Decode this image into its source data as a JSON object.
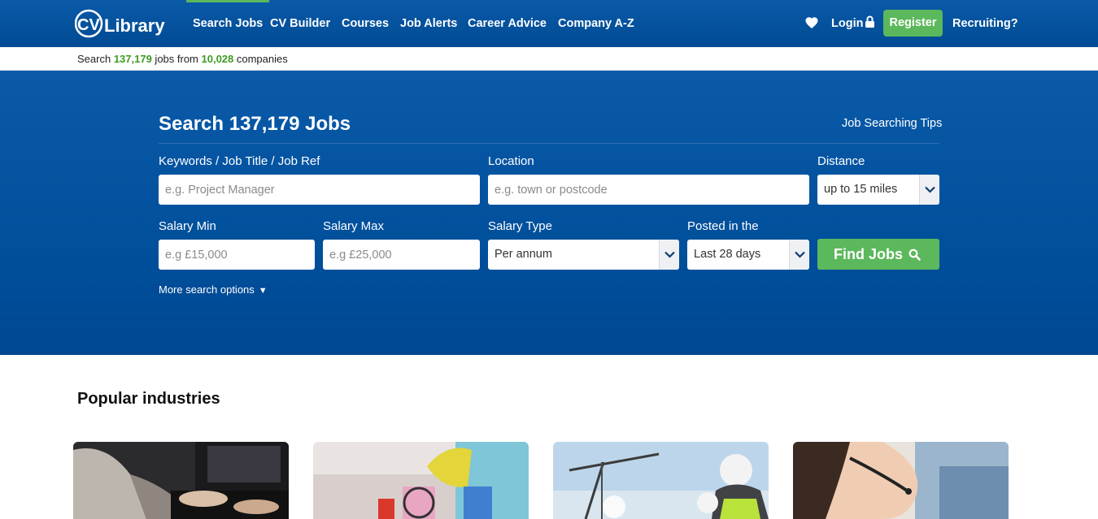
{
  "brand": {
    "logo_text": "CV Library"
  },
  "nav": {
    "items": [
      {
        "label": "Search Jobs",
        "active": true
      },
      {
        "label": "CV Builder"
      },
      {
        "label": "Courses"
      },
      {
        "label": "Job Alerts"
      },
      {
        "label": "Career Advice"
      },
      {
        "label": "Company A-Z"
      }
    ],
    "login_label": "Login",
    "register_label": "Register",
    "recruiting_label": "Recruiting?",
    "icons": [
      "heart-icon",
      "lock-icon"
    ]
  },
  "stats": {
    "prefix": "Search ",
    "jobs_count": "137,179",
    "middle": " jobs from ",
    "companies_count": "10,028",
    "suffix": " companies"
  },
  "search": {
    "title": "Search 137,179 Jobs",
    "tips_link": "Job Searching Tips",
    "keywords": {
      "label": "Keywords / Job Title / Job Ref",
      "placeholder": "e.g. Project Manager",
      "value": ""
    },
    "location": {
      "label": "Location",
      "placeholder": "e.g. town or postcode",
      "value": ""
    },
    "distance": {
      "label": "Distance",
      "selected": "up to 15 miles"
    },
    "salary_min": {
      "label": "Salary Min",
      "placeholder": "e.g £15,000",
      "value": ""
    },
    "salary_max": {
      "label": "Salary Max",
      "placeholder": "e.g £25,000",
      "value": ""
    },
    "salary_type": {
      "label": "Salary Type",
      "selected": "Per annum"
    },
    "posted": {
      "label": "Posted in the",
      "selected": "Last 28 days"
    },
    "find_button": "Find Jobs",
    "more_options": "More search options"
  },
  "industries": {
    "title": "Popular industries"
  },
  "colors": {
    "primary_blue": "#00509c",
    "accent_green": "#5cb85c",
    "stat_green": "#3f9b22"
  }
}
